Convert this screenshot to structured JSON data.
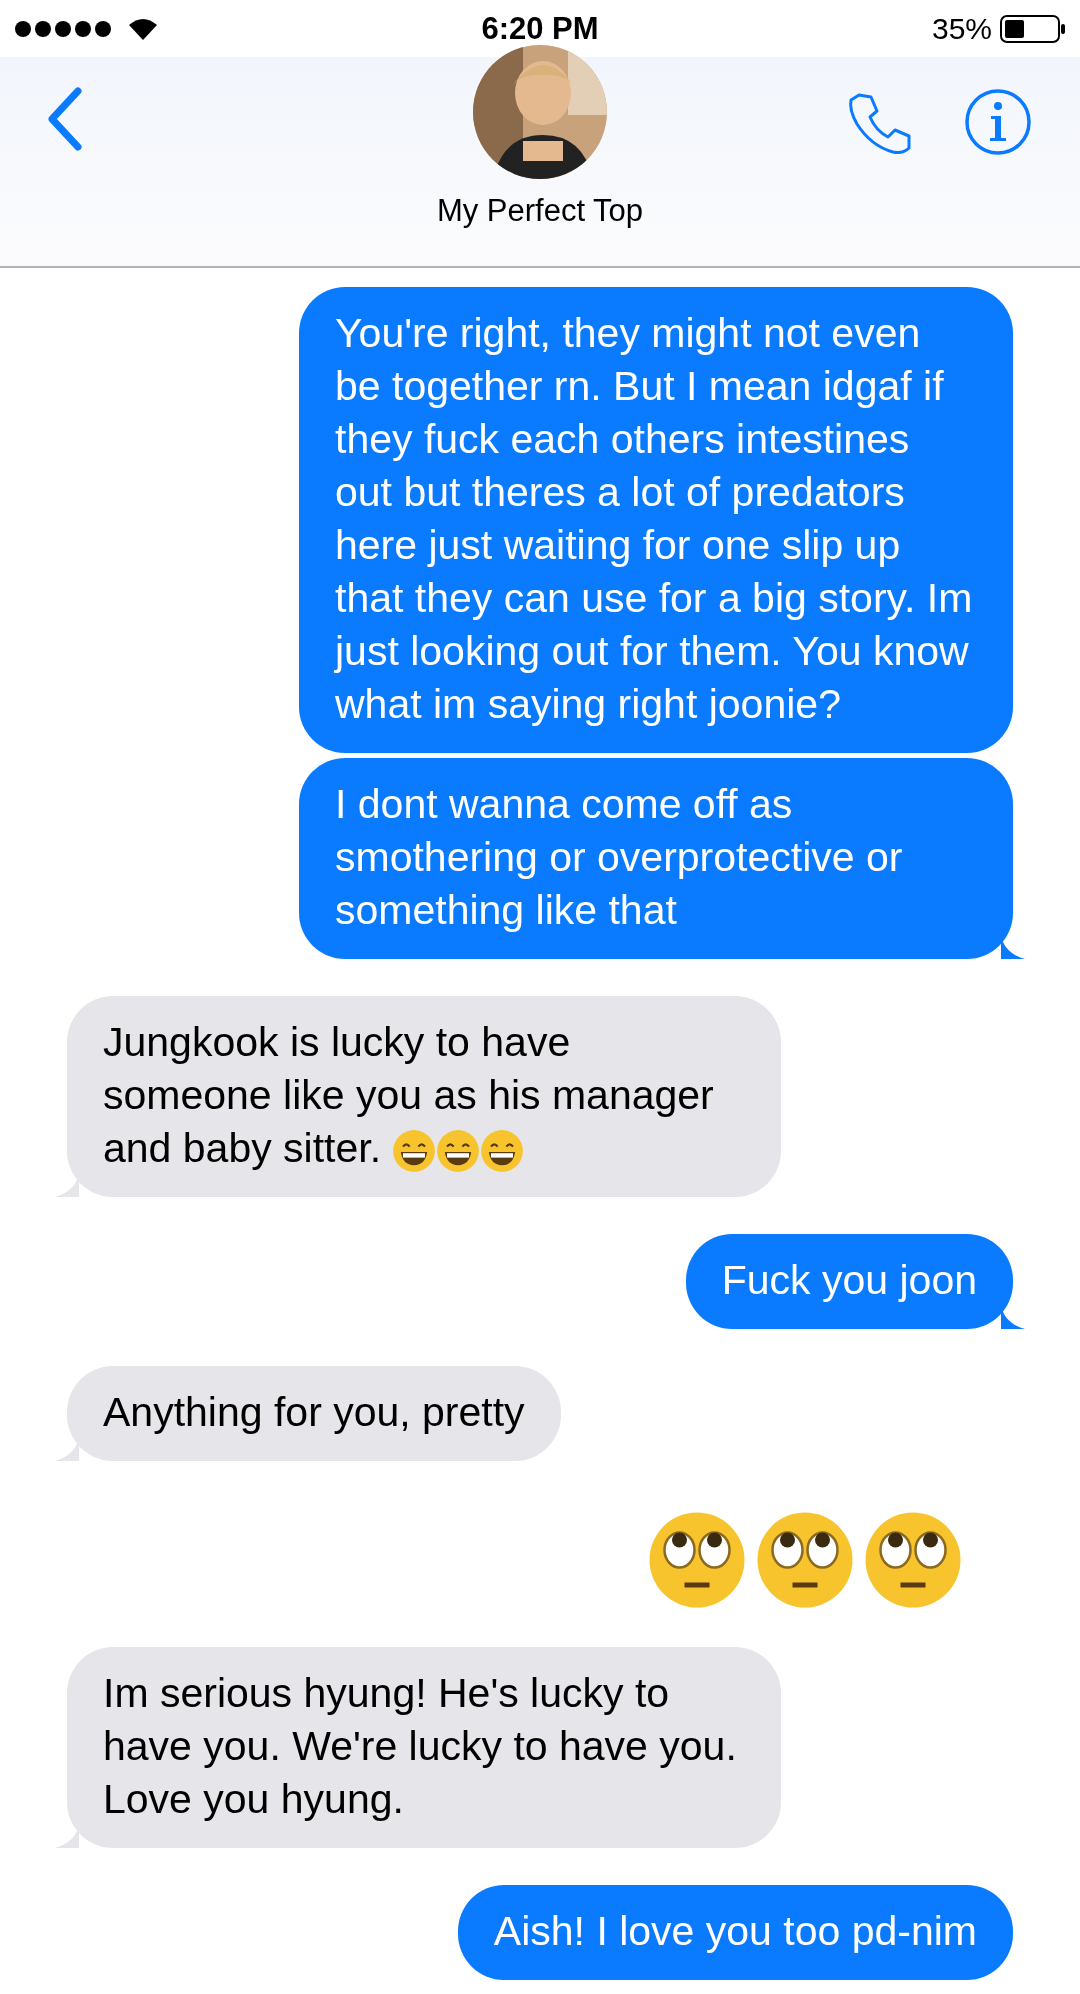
{
  "status_bar": {
    "time": "6:20 PM",
    "battery": "35%"
  },
  "contact": {
    "name": "My Perfect Top"
  },
  "messages": [
    {
      "outgoing": true,
      "tail": false,
      "text": "You're right, they might not even be together rn. But I mean idgaf if they fuck each others intestines out but theres a lot of predators here just waiting for one slip up that they can use for a big story. Im just looking out for them. You know what im saying right joonie?"
    },
    {
      "outgoing": true,
      "tail": true,
      "text": "I dont wanna come off as smothering or overprotective or something like that"
    },
    {
      "outgoing": false,
      "tail": true,
      "text": "Jungkook is lucky to have someone like you as his manager and baby sitter.",
      "emoji": [
        {
          "kind": "grin"
        },
        {
          "kind": "grin"
        },
        {
          "kind": "grin"
        }
      ]
    },
    {
      "outgoing": true,
      "tail": true,
      "text": "Fuck you joon"
    },
    {
      "outgoing": false,
      "tail": true,
      "text": "Anything for you, pretty"
    },
    {
      "outgoing": true,
      "big_emoji": [
        {
          "kind": "eyeroll"
        },
        {
          "kind": "eyeroll"
        },
        {
          "kind": "eyeroll"
        }
      ]
    },
    {
      "outgoing": false,
      "tail": true,
      "text": "Im serious hyung! He's lucky to have you. We're lucky to have you. Love you hyung."
    },
    {
      "outgoing": true,
      "tail": false,
      "text": "Aish! I love you too pd-nim"
    }
  ]
}
